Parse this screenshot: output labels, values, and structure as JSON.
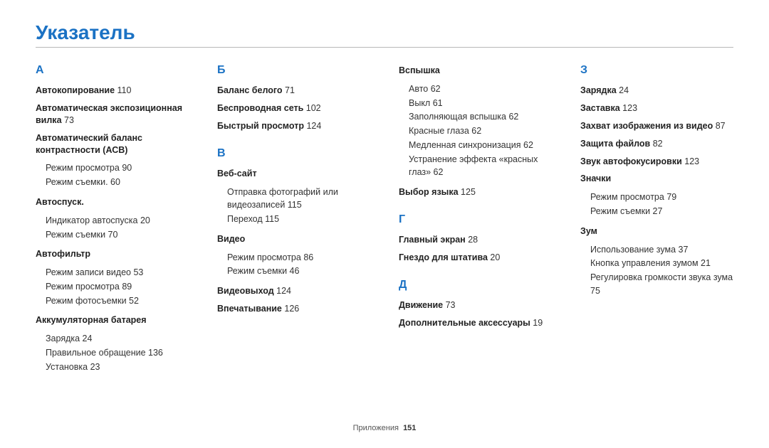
{
  "title": "Указатель",
  "footer": {
    "section": "Приложения",
    "page": "151"
  },
  "cols": [
    [
      {
        "type": "letter",
        "text": "А"
      },
      {
        "type": "topic",
        "term": "Автокопирование",
        "page": "110"
      },
      {
        "type": "topic",
        "term": "Автоматическая экспозиционная вилка",
        "page": "73"
      },
      {
        "type": "topic",
        "term": "Автоматический баланс контрастности (АСВ)",
        "subs": [
          {
            "text": "Режим просмотра",
            "page": "90"
          },
          {
            "text": "Режим съемки.",
            "page": "60"
          }
        ]
      },
      {
        "type": "topic",
        "term": "Автоспуск.",
        "subs": [
          {
            "text": "Индикатор автоспуска",
            "page": "20"
          },
          {
            "text": "Режим съемки",
            "page": "70"
          }
        ],
        "mt": true
      },
      {
        "type": "topic",
        "term": "Автофильтр",
        "subs": [
          {
            "text": "Режим записи видео",
            "page": "53"
          },
          {
            "text": "Режим просмотра",
            "page": "89"
          },
          {
            "text": "Режим фотосъемки",
            "page": "52"
          }
        ],
        "mt": true
      },
      {
        "type": "topic",
        "term": "Аккумуляторная батарея",
        "subs": [
          {
            "text": "Зарядка",
            "page": "24"
          },
          {
            "text": "Правильное обращение",
            "page": "136"
          },
          {
            "text": "Установка",
            "page": "23"
          }
        ],
        "mt": true
      }
    ],
    [
      {
        "type": "letter",
        "text": "Б"
      },
      {
        "type": "topic",
        "term": "Баланс белого",
        "page": "71"
      },
      {
        "type": "topic",
        "term": "Беспроводная сеть",
        "page": "102"
      },
      {
        "type": "topic",
        "term": "Быстрый просмотр",
        "page": "124"
      },
      {
        "type": "letter",
        "text": "В",
        "mt": true
      },
      {
        "type": "topic",
        "term": "Веб-сайт",
        "subs": [
          {
            "text": "Отправка фотографий или видеозаписей",
            "page": "115"
          },
          {
            "text": "Переход",
            "page": "115"
          }
        ]
      },
      {
        "type": "topic",
        "term": "Видео",
        "subs": [
          {
            "text": "Режим просмотра",
            "page": "86"
          },
          {
            "text": "Режим съемки",
            "page": "46"
          }
        ],
        "mt": true
      },
      {
        "type": "topic",
        "term": "Видеовыход",
        "page": "124",
        "mt": true
      },
      {
        "type": "topic",
        "term": "Впечатывание",
        "page": "126"
      }
    ],
    [
      {
        "type": "topic",
        "term": "Вспышка",
        "subs": [
          {
            "text": "Авто",
            "page": "62"
          },
          {
            "text": "Выкл",
            "page": "61"
          },
          {
            "text": "Заполняющая вспышка",
            "page": "62"
          },
          {
            "text": "Красные глаза",
            "page": "62"
          },
          {
            "text": "Медленная синхронизация",
            "page": "62"
          },
          {
            "text": "Устранение эффекта «красных глаз»",
            "page": "62"
          }
        ]
      },
      {
        "type": "topic",
        "term": "Выбор языка",
        "page": "125",
        "mt": true
      },
      {
        "type": "letter",
        "text": "Г",
        "mt": true
      },
      {
        "type": "topic",
        "term": "Главный экран",
        "page": "28"
      },
      {
        "type": "topic",
        "term": "Гнездо для штатива",
        "page": "20"
      },
      {
        "type": "letter",
        "text": "Д",
        "mt": true
      },
      {
        "type": "topic",
        "term": "Движение",
        "page": "73"
      },
      {
        "type": "topic",
        "term": "Дополнительные аксессуары",
        "page": "19"
      }
    ],
    [
      {
        "type": "letter",
        "text": "З"
      },
      {
        "type": "topic",
        "term": "Зарядка",
        "page": "24"
      },
      {
        "type": "topic",
        "term": "Заставка",
        "page": "123"
      },
      {
        "type": "topic",
        "term": "Захват изображения из видео",
        "page": "87"
      },
      {
        "type": "topic",
        "term": "Защита файлов",
        "page": "82"
      },
      {
        "type": "topic",
        "term": "Звук автофокусировки",
        "page": "123"
      },
      {
        "type": "topic",
        "term": "Значки",
        "subs": [
          {
            "text": "Режим просмотра",
            "page": "79"
          },
          {
            "text": "Режим съемки",
            "page": "27"
          }
        ]
      },
      {
        "type": "topic",
        "term": "Зум",
        "subs": [
          {
            "text": "Использование зума",
            "page": "37"
          },
          {
            "text": "Кнопка управления зумом",
            "page": "21"
          },
          {
            "text": "Регулировка громкости звука зума",
            "page": "75"
          }
        ],
        "mt": true
      }
    ]
  ]
}
